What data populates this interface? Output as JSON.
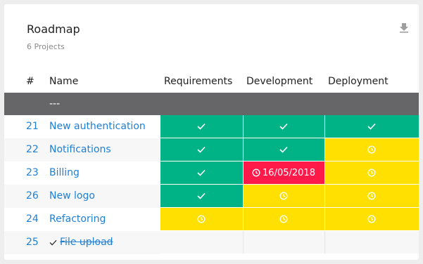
{
  "card": {
    "title": "Roadmap",
    "subtitle": "6 Projects",
    "download_icon": "download-icon"
  },
  "table": {
    "headers": {
      "num": "#",
      "name": "Name",
      "stages": [
        "Requirements",
        "Development",
        "Deployment"
      ]
    },
    "group_label": "---",
    "rows": [
      {
        "num": "21",
        "name": "New authentication",
        "completed": false,
        "stages": [
          "done",
          "done",
          "done"
        ]
      },
      {
        "num": "22",
        "name": "Notifications",
        "completed": false,
        "stages": [
          "done",
          "done",
          "pending"
        ]
      },
      {
        "num": "23",
        "name": "Billing",
        "completed": false,
        "stages": [
          "done",
          "late",
          "pending"
        ],
        "late_date": "16/05/2018"
      },
      {
        "num": "26",
        "name": "New logo",
        "completed": false,
        "stages": [
          "done",
          "pending",
          "pending"
        ]
      },
      {
        "num": "24",
        "name": "Refactoring",
        "completed": false,
        "stages": [
          "pending",
          "pending",
          "pending"
        ]
      },
      {
        "num": "25",
        "name": "File upload",
        "completed": true,
        "stages": [
          "empty",
          "empty",
          "empty"
        ]
      }
    ]
  },
  "colors": {
    "done": "#00b386",
    "pending": "#ffe000",
    "late": "#ff1a4a",
    "link": "#1e7fd6",
    "group": "#666669"
  }
}
